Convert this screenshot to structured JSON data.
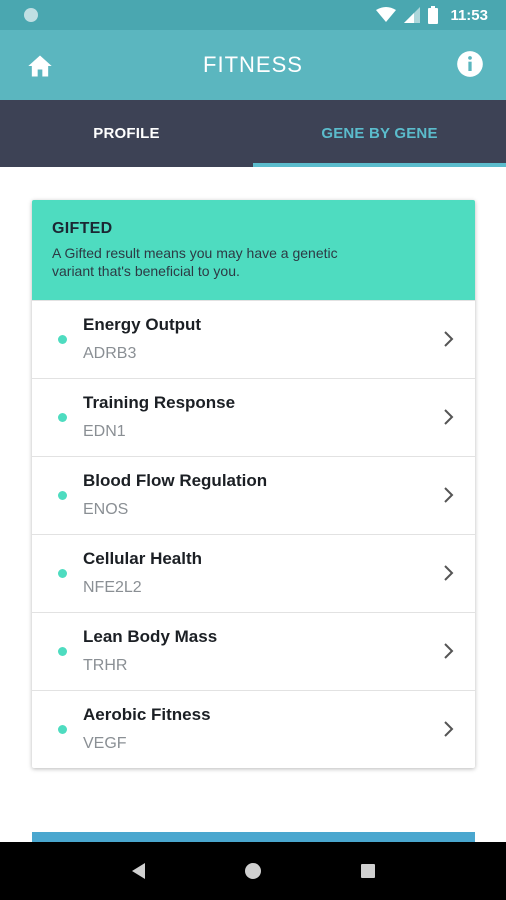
{
  "status_bar": {
    "time": "11:53"
  },
  "app_bar": {
    "title": "FITNESS",
    "left_icon": "home-icon",
    "right_icon": "info-icon"
  },
  "tabs": [
    {
      "label": "PROFILE",
      "active": false
    },
    {
      "label": "GENE BY GENE",
      "active": true
    }
  ],
  "card": {
    "title": "GIFTED",
    "description_line1": "A Gifted result means you may have a genetic",
    "description_line2": "variant that's beneficial to you.",
    "items": [
      {
        "name": "Energy Output",
        "gene": "ADRB3"
      },
      {
        "name": "Training Response",
        "gene": "EDN1"
      },
      {
        "name": "Blood Flow Regulation",
        "gene": "ENOS"
      },
      {
        "name": "Cellular Health",
        "gene": "NFE2L2"
      },
      {
        "name": "Lean Body Mass",
        "gene": "TRHR"
      },
      {
        "name": "Aerobic Fitness",
        "gene": "VEGF"
      }
    ]
  },
  "colors": {
    "status_bar": "#4aa7b0",
    "app_bar": "#5bb6bf",
    "tab_bar": "#3d4255",
    "accent": "#5bbccc",
    "gifted": "#4edcc0"
  },
  "nav_bar": {
    "buttons": [
      "back-icon",
      "home-circle-icon",
      "recents-icon"
    ]
  }
}
